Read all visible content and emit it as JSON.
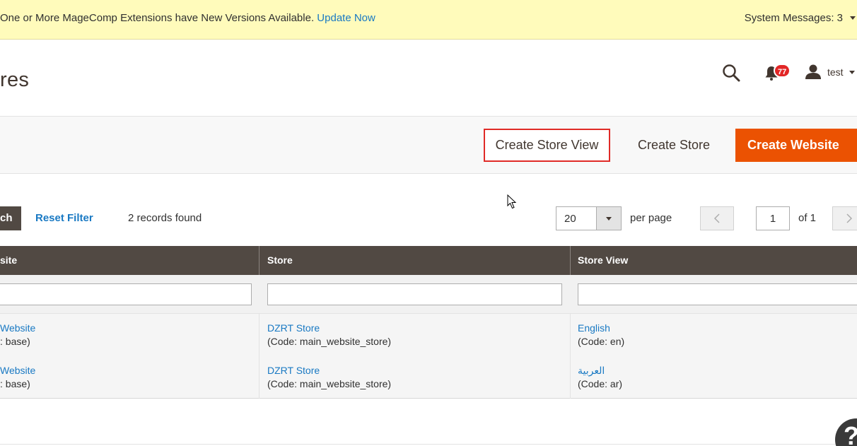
{
  "notice": {
    "message": "One or More MageComp Extensions have New Versions Available.",
    "link_label": "Update Now",
    "system_messages": "System Messages: 3"
  },
  "header": {
    "title": "res",
    "notification_count": "77",
    "username": "test"
  },
  "actions": {
    "create_store_view": "Create Store View",
    "create_store": "Create Store",
    "create_website": "Create Website"
  },
  "toolbar": {
    "search_label": "ch",
    "reset_filter": "Reset Filter",
    "records_found": "2 records found",
    "per_page_value": "20",
    "per_page_label": "per page",
    "page_value": "1",
    "page_of": "of 1"
  },
  "grid": {
    "columns": [
      "site",
      "Store",
      "Store View"
    ],
    "rows": [
      {
        "website": "Website",
        "website_code": ": base)",
        "store": "DZRT Store",
        "store_code": "(Code: main_website_store)",
        "store_view": "English",
        "store_view_code": "(Code: en)"
      },
      {
        "website": "Website",
        "website_code": ": base)",
        "store": "DZRT Store",
        "store_code": "(Code: main_website_store)",
        "store_view": "العربية",
        "store_view_code": "(Code: ar)"
      }
    ]
  },
  "colors": {
    "notice_bg": "#fffbbb",
    "link": "#1979c3",
    "accent_orange": "#eb5202",
    "grid_header": "#514943",
    "highlight_red": "#e02b27",
    "badge_red": "#e22626"
  },
  "icons": [
    "search-icon",
    "bell-icon",
    "user-icon",
    "chevron-left-icon",
    "chevron-right-icon",
    "mouse-cursor-icon",
    "help-icon"
  ]
}
